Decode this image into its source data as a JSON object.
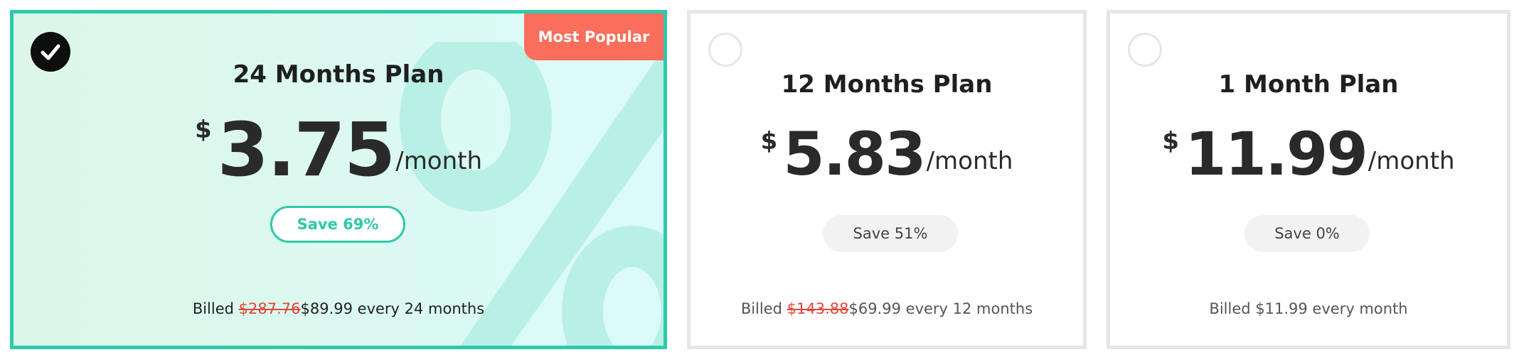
{
  "colors": {
    "accent": "#2ec9a9",
    "ribbon": "#fb6e5b",
    "strike": "#e2473b",
    "border_inactive": "#e6e6e6"
  },
  "plans": [
    {
      "title": "24 Months Plan",
      "currency": "$",
      "price": "3.75",
      "period": "/month",
      "save": "Save 69%",
      "billed_prefix": "Billed ",
      "billed_original": "$287.76",
      "billed_price": "$89.99",
      "billed_suffix": " every 24 months",
      "badge": "Most Popular",
      "selected": true,
      "icon": "checkmark-icon"
    },
    {
      "title": "12 Months Plan",
      "currency": "$",
      "price": "5.83",
      "period": "/month",
      "save": "Save 51%",
      "billed_prefix": "Billed ",
      "billed_original": "$143.88",
      "billed_price": "$69.99",
      "billed_suffix": " every 12 months",
      "selected": false,
      "icon": "radio-circle-icon"
    },
    {
      "title": "1 Month Plan",
      "currency": "$",
      "price": "11.99",
      "period": "/month",
      "save": "Save 0%",
      "billed_text": "Billed $11.99 every month",
      "selected": false,
      "icon": "radio-circle-icon"
    }
  ]
}
